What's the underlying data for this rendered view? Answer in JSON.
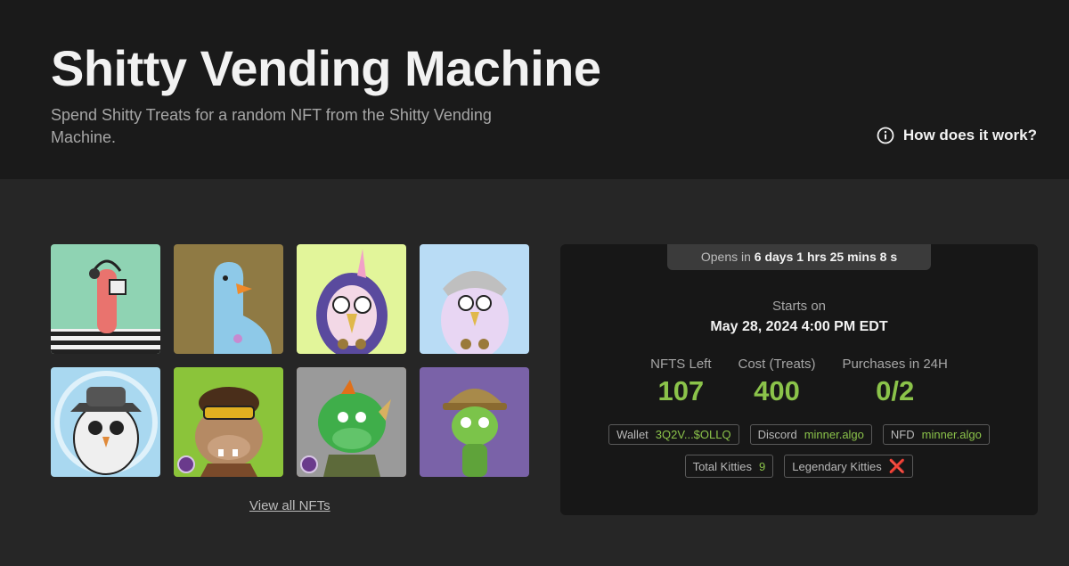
{
  "header": {
    "title": "Shitty Vending Machine",
    "subtitle": "Spend Shitty Treats for a random NFT from the Shitty Vending Machine.",
    "help_label": "How does it work?"
  },
  "gallery": {
    "view_all_label": "View all NFTs",
    "tiles": [
      {
        "bg": "#8fd3b3"
      },
      {
        "bg": "#8f7a44"
      },
      {
        "bg": "#e2f59a"
      },
      {
        "bg": "#b9dcf5"
      },
      {
        "bg": "#a9d8f0"
      },
      {
        "bg": "#8bc43a"
      },
      {
        "bg": "#9a9a9a"
      },
      {
        "bg": "#7a62a8"
      }
    ]
  },
  "panel": {
    "countdown_prefix": "Opens in",
    "countdown_value": "6 days 1 hrs 25 mins 8 s",
    "starts_label": "Starts on",
    "starts_date": "May 28, 2024 4:00 PM EDT",
    "stats": [
      {
        "label": "NFTS Left",
        "value": "107"
      },
      {
        "label": "Cost (Treats)",
        "value": "400"
      },
      {
        "label": "Purchases in 24H",
        "value": "0/2"
      }
    ],
    "chips": {
      "wallet_label": "Wallet",
      "wallet_value": "3Q2V...$OLLQ",
      "discord_label": "Discord",
      "discord_value": "minner.algo",
      "nfd_label": "NFD",
      "nfd_value": "minner.algo",
      "kitties_label": "Total Kitties",
      "kitties_value": "9",
      "legendary_label": "Legendary Kitties",
      "legendary_value": "❌"
    }
  }
}
